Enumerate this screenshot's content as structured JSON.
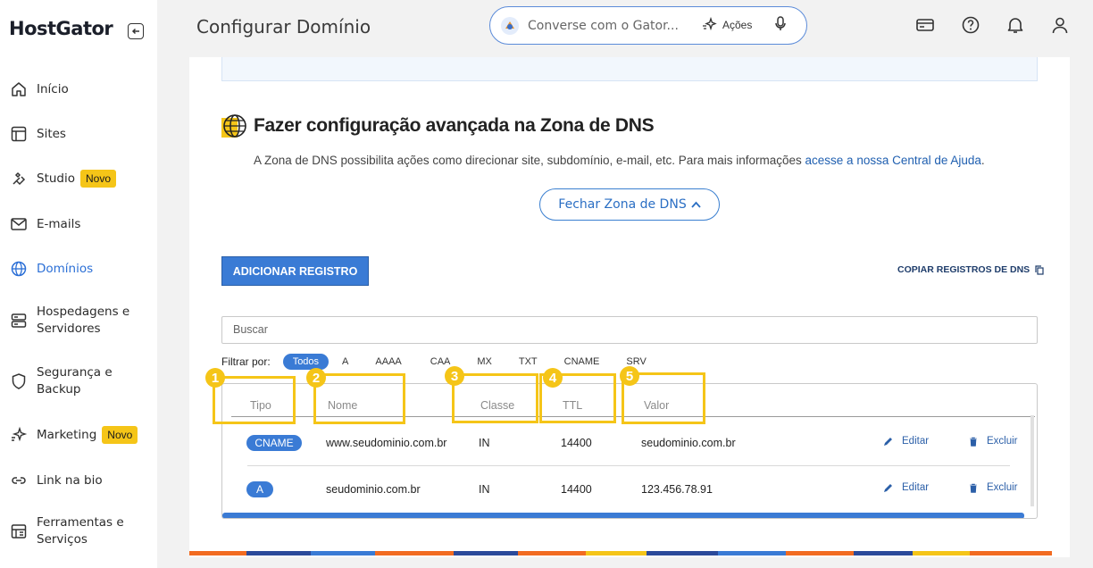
{
  "sidebar": {
    "logo": "HostGator",
    "items": [
      {
        "label": "Início",
        "icon": "home-icon"
      },
      {
        "label": "Sites",
        "icon": "layout-icon"
      },
      {
        "label": "Studio",
        "icon": "studio-icon",
        "badge": "Novo"
      },
      {
        "label": "E-mails",
        "icon": "mail-icon"
      },
      {
        "label": "Domínios",
        "icon": "globe-icon",
        "active": true
      },
      {
        "label": "Hospedagens e Servidores",
        "icon": "server-icon"
      },
      {
        "label": "Segurança e Backup",
        "icon": "shield-icon"
      },
      {
        "label": "Marketing",
        "icon": "sparkle-icon",
        "badge": "Novo"
      },
      {
        "label": "Link na bio",
        "icon": "link-icon"
      },
      {
        "label": "Ferramentas e Serviços",
        "icon": "tools-icon"
      }
    ]
  },
  "header": {
    "title": "Configurar Domínio",
    "search_placeholder": "Converse com o Gator...",
    "actions_label": "Ações"
  },
  "dns": {
    "title": "Fazer configuração avançada na Zona de DNS",
    "description": "A Zona de DNS possibilita ações como direcionar site, subdomínio, e-mail, etc. Para mais informações ",
    "help_link": "acesse a nossa Central de Ajuda",
    "description_end": ".",
    "close_button": "Fechar Zona de DNS",
    "add_button": "ADICIONAR REGISTRO",
    "copy_link": "COPIAR REGISTROS DE DNS",
    "search_placeholder": "Buscar",
    "filter_label": "Filtrar por:",
    "filters": [
      "Todos",
      "A",
      "AAAA",
      "CAA",
      "MX",
      "TXT",
      "CNAME",
      "SRV"
    ],
    "active_filter": "Todos",
    "columns": [
      "Tipo",
      "Nome",
      "Classe",
      "TTL",
      "Valor"
    ],
    "records": [
      {
        "type": "CNAME",
        "name": "www.seudominio.com.br",
        "class": "IN",
        "ttl": "14400",
        "value": "seudominio.com.br",
        "edit": "Editar",
        "delete": "Excluir"
      },
      {
        "type": "A",
        "name": "seudominio.com.br",
        "class": "IN",
        "ttl": "14400",
        "value": "123.456.78.91",
        "edit": "Editar",
        "delete": "Excluir"
      }
    ]
  },
  "annotations": [
    "1",
    "2",
    "3",
    "4",
    "5"
  ],
  "colors": {
    "accent": "#3a7bd5",
    "highlight": "#f5c518",
    "active_nav": "#2b6fd6"
  }
}
